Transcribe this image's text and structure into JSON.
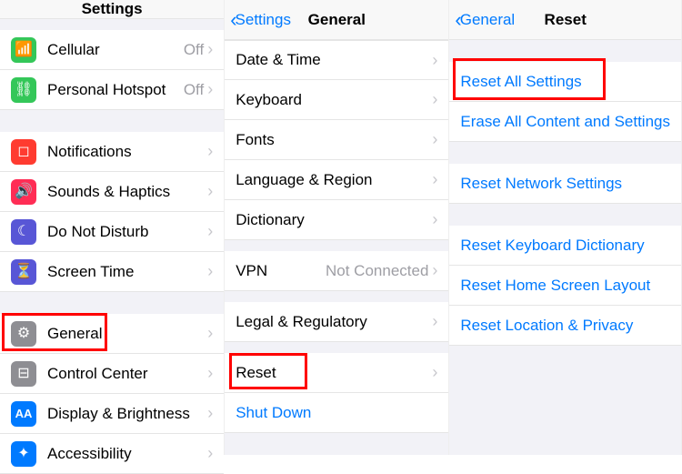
{
  "panes": {
    "settings": {
      "title": "Settings",
      "items": {
        "cellular": {
          "label": "Cellular",
          "detail": "Off"
        },
        "hotspot": {
          "label": "Personal Hotspot",
          "detail": "Off"
        },
        "notifications": {
          "label": "Notifications"
        },
        "sounds": {
          "label": "Sounds & Haptics"
        },
        "dnd": {
          "label": "Do Not Disturb"
        },
        "screentime": {
          "label": "Screen Time"
        },
        "general": {
          "label": "General"
        },
        "control": {
          "label": "Control Center"
        },
        "display": {
          "label": "Display & Brightness"
        },
        "accessibility": {
          "label": "Accessibility"
        }
      }
    },
    "general": {
      "back": "Settings",
      "title": "General",
      "items": {
        "datetime": {
          "label": "Date & Time"
        },
        "keyboard": {
          "label": "Keyboard"
        },
        "fonts": {
          "label": "Fonts"
        },
        "lang": {
          "label": "Language & Region"
        },
        "dict": {
          "label": "Dictionary"
        },
        "vpn": {
          "label": "VPN",
          "detail": "Not Connected"
        },
        "legal": {
          "label": "Legal & Regulatory"
        },
        "reset": {
          "label": "Reset"
        },
        "shutdown": {
          "label": "Shut Down"
        }
      }
    },
    "reset": {
      "back": "General",
      "title": "Reset",
      "items": {
        "all": {
          "label": "Reset All Settings"
        },
        "erase": {
          "label": "Erase All Content and Settings"
        },
        "network": {
          "label": "Reset Network Settings"
        },
        "keyboard": {
          "label": "Reset Keyboard Dictionary"
        },
        "home": {
          "label": "Reset Home Screen Layout"
        },
        "location": {
          "label": "Reset Location & Privacy"
        }
      }
    }
  }
}
